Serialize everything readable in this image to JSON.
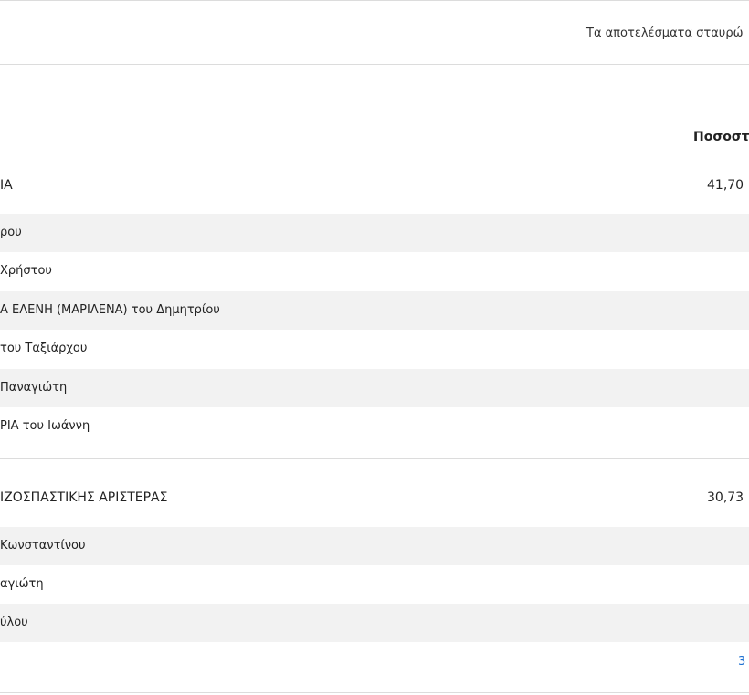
{
  "header": {
    "note": "Τα αποτελέσματα σταυρώ"
  },
  "table": {
    "column_header": "Ποσοστ"
  },
  "parties": [
    {
      "name": "ΙΑ",
      "percent": "41,70",
      "candidates": [
        "ρου",
        "Χρήστου",
        "Α ΕΛΕΝΗ (ΜΑΡΙΛΕΝΑ) του Δημητρίου",
        "του Ταξιάρχου",
        "Παναγιώτη",
        "ΡΙΑ του Ιωάννη"
      ]
    },
    {
      "name": "ΙΖΟΣΠΑΣΤΙΚΗΣ ΑΡΙΣΤΕΡΑΣ",
      "percent": "30,73",
      "candidates": [
        "Κωνσταντίνου",
        "αγιώτη",
        "ύλου"
      ]
    }
  ],
  "pagination": {
    "link": "3"
  }
}
